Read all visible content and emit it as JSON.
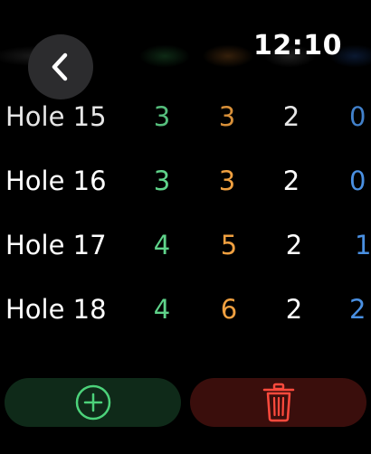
{
  "header": {
    "time": "12:10",
    "back_icon": "chevron-left-icon"
  },
  "rows": [
    {
      "hole": "Hole 15",
      "v1": "3",
      "v2": "3",
      "v3": "2",
      "v4": "0"
    },
    {
      "hole": "Hole 16",
      "v1": "3",
      "v2": "3",
      "v3": "2",
      "v4": "0"
    },
    {
      "hole": "Hole 17",
      "v1": "4",
      "v2": "5",
      "v3": "2",
      "v4": "1"
    },
    {
      "hole": "Hole 18",
      "v1": "4",
      "v2": "6",
      "v3": "2",
      "v4": "2"
    }
  ],
  "actions": {
    "add_icon": "plus-circle-icon",
    "delete_icon": "trash-icon"
  },
  "colors": {
    "col1": "#5fd38a",
    "col2": "#f0a040",
    "col3": "#ffffff",
    "col4": "#4a90e2",
    "add_bg": "#0f2a19",
    "delete_bg": "#3a0e0c",
    "back_bg": "#2c2c2e"
  }
}
